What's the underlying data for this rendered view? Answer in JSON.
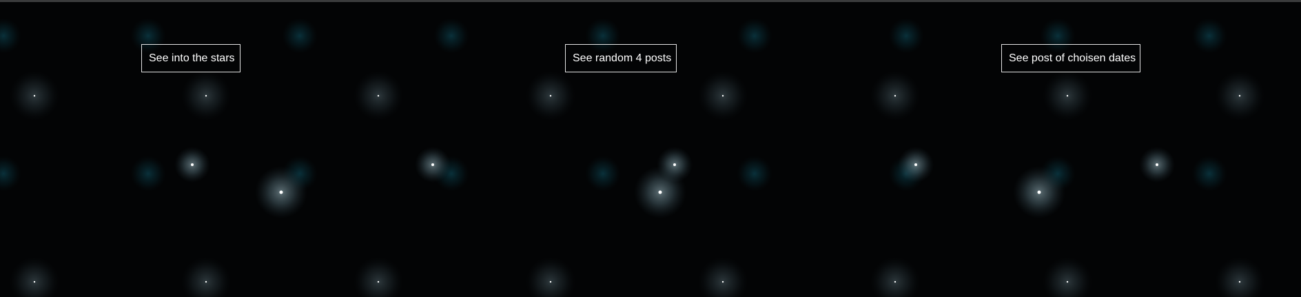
{
  "nav": {
    "stars_label": "See into the stars",
    "random_label": "See random 4 posts",
    "dates_label": "See post of choisen dates"
  },
  "theme": {
    "background": "#030405",
    "star_core": "#ffffff",
    "glow_bright": "#7fa6b4",
    "glow_teal": "#0e4a57",
    "button_border": "#e6e6e6",
    "button_text": "#ffffff"
  }
}
